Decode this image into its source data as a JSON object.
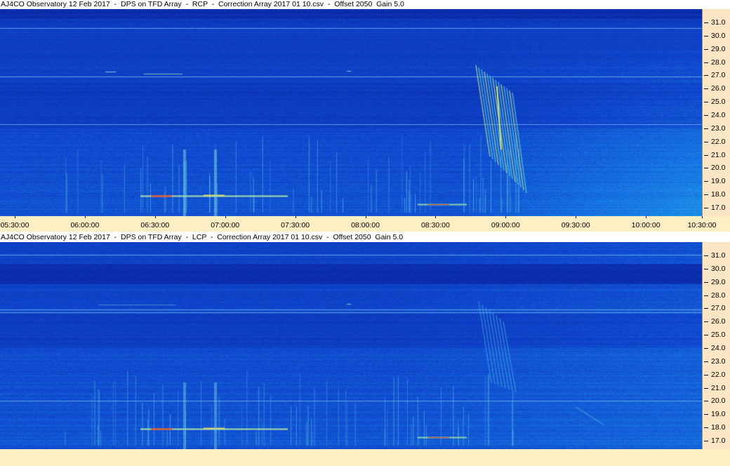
{
  "panels": [
    {
      "id": "rcp",
      "title": "AJ4CO Observatory 12 Feb 2017  -  DPS on TFD Array  -  RCP  -  Correction Array 2017 01 10.csv  -  Offset 2050  Gain 5.0",
      "y_labels": [
        "31.0",
        "30.0",
        "29.0",
        "28.0",
        "27.0",
        "26.0",
        "25.0",
        "24.0",
        "23.0",
        "22.0",
        "21.0",
        "20.0",
        "19.0",
        "18.0",
        "17.0"
      ],
      "x_labels": [
        "05:30:00",
        "06:00:00",
        "06:30:00",
        "07:00:00",
        "07:30:00",
        "08:00:00",
        "08:30:00",
        "09:00:00",
        "09:30:00",
        "10:00:00",
        "10:30:00"
      ]
    },
    {
      "id": "lcp",
      "title": "AJ4CO Observatory 12 Feb 2017  -  DPS on TFD Array  -  LCP  -  Correction Array 2017 01 10.csv  -  Offset 2050  Gain 5.0",
      "y_labels": [
        "31.0",
        "30.0",
        "29.0",
        "28.0",
        "27.0",
        "26.0",
        "25.0",
        "24.0",
        "23.0",
        "22.0",
        "21.0",
        "20.0",
        "19.0",
        "18.0",
        "17.0"
      ],
      "x_labels": []
    }
  ],
  "colors": {
    "axis_bg": "#fde6c4",
    "background_deep": "#0a2db4",
    "background_light": "#1e96e6",
    "burst": "#9ce6aa",
    "hot": "#ff2a00"
  }
}
